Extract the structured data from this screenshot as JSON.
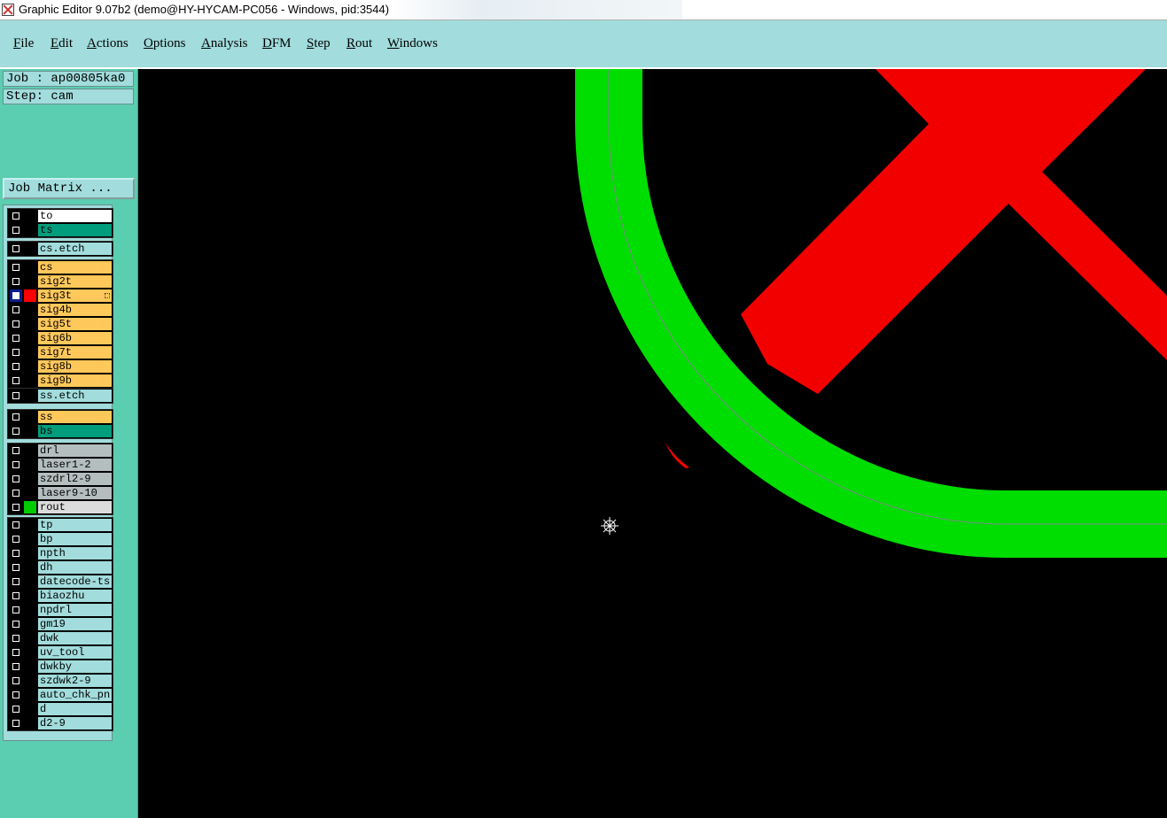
{
  "window": {
    "title": "Graphic Editor 9.07b2 (demo@HY-HYCAM-PC056 - Windows, pid:3544)"
  },
  "menu": [
    {
      "key": "F",
      "rest": "ile"
    },
    {
      "key": "E",
      "rest": "dit"
    },
    {
      "key": "A",
      "rest": "ctions"
    },
    {
      "key": "O",
      "rest": "ptions"
    },
    {
      "key": "A",
      "rest": "nalysis"
    },
    {
      "key": "D",
      "rest": "FM"
    },
    {
      "key": "S",
      "rest": "tep"
    },
    {
      "key": "R",
      "rest": "out"
    },
    {
      "key": "W",
      "rest": "indows"
    }
  ],
  "job": {
    "label": "Job : ap00805ka0",
    "step": "Step: cam",
    "matrix_button": "Job Matrix ..."
  },
  "layer_groups": [
    {
      "layers": [
        {
          "name": "to",
          "color": "#ffffff",
          "checked": false
        },
        {
          "name": "ts",
          "color": "#009d7c",
          "checked": false
        }
      ]
    },
    {
      "layers": [
        {
          "name": "cs.etch",
          "color": "#a2dcdc",
          "checked": false
        }
      ]
    },
    {
      "layers": [
        {
          "name": "cs",
          "color": "#ffc85a",
          "checked": false
        },
        {
          "name": "sig2t",
          "color": "#ffc85a",
          "checked": false
        },
        {
          "name": "sig3t",
          "color": "#ffc85a",
          "checked": true,
          "display_color": "#ff0000",
          "work": true
        },
        {
          "name": "sig4b",
          "color": "#ffc85a",
          "checked": false
        },
        {
          "name": "sig5t",
          "color": "#ffc85a",
          "checked": false
        },
        {
          "name": "sig6b",
          "color": "#ffc85a",
          "checked": false
        },
        {
          "name": "sig7t",
          "color": "#ffc85a",
          "checked": false
        },
        {
          "name": "sig8b",
          "color": "#ffc85a",
          "checked": false
        },
        {
          "name": "sig9b",
          "color": "#ffc85a",
          "checked": false
        }
      ]
    },
    {
      "layers": [
        {
          "name": "ss.etch",
          "color": "#a2dcdc",
          "checked": false
        }
      ]
    },
    {
      "layers": [
        {
          "name": "ss",
          "color": "#ffc85a",
          "checked": false
        },
        {
          "name": "bs",
          "color": "#009d7c",
          "checked": false
        }
      ]
    },
    {
      "layers": [
        {
          "name": "drl",
          "color": "#b4bebe",
          "checked": false
        },
        {
          "name": "laser1-2",
          "color": "#b4bebe",
          "checked": false
        },
        {
          "name": "szdrl2-9",
          "color": "#b4bebe",
          "checked": false
        },
        {
          "name": "laser9-10",
          "color": "#b4bebe",
          "checked": false
        },
        {
          "name": "rout",
          "color": "#dcdcdc",
          "checked": false,
          "display_color": "#00cc00"
        }
      ]
    },
    {
      "layers": [
        {
          "name": "tp",
          "color": "#a2dcdc",
          "checked": false
        },
        {
          "name": "bp",
          "color": "#a2dcdc",
          "checked": false
        },
        {
          "name": "npth",
          "color": "#a2dcdc",
          "checked": false
        },
        {
          "name": "dh",
          "color": "#a2dcdc",
          "checked": false
        },
        {
          "name": "datecode-ts",
          "color": "#a2dcdc",
          "checked": false
        },
        {
          "name": "biaozhu",
          "color": "#a2dcdc",
          "checked": false
        },
        {
          "name": "npdrl",
          "color": "#a2dcdc",
          "checked": false
        },
        {
          "name": "gm19",
          "color": "#a2dcdc",
          "checked": false
        },
        {
          "name": "dwk",
          "color": "#a2dcdc",
          "checked": false
        },
        {
          "name": "uv_tool",
          "color": "#a2dcdc",
          "checked": false
        },
        {
          "name": "dwkby",
          "color": "#a2dcdc",
          "checked": false
        },
        {
          "name": "szdwk2-9",
          "color": "#a2dcdc",
          "checked": false
        },
        {
          "name": "auto_chk_pn",
          "color": "#a2dcdc",
          "checked": false
        },
        {
          "name": "d",
          "color": "#a2dcdc",
          "checked": false
        },
        {
          "name": "d2-9",
          "color": "#a2dcdc",
          "checked": false
        }
      ]
    }
  ],
  "colors": {
    "signal": "#f20000",
    "rout": "#00dd00",
    "background": "#000000",
    "panel": "#5bcdb0",
    "menu": "#a2dcdc"
  }
}
